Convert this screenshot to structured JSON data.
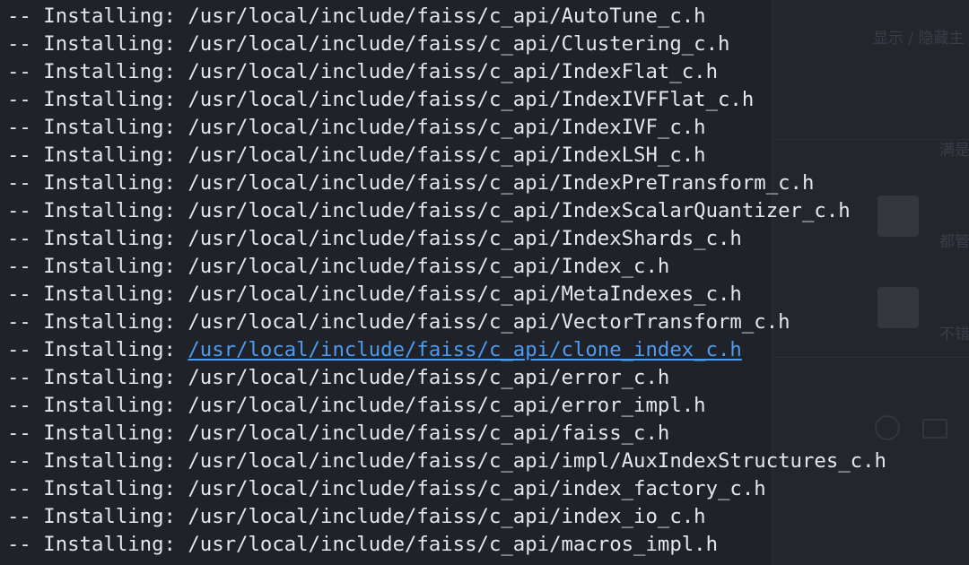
{
  "terminal": {
    "prefix": "-- Installing: ",
    "lines": [
      {
        "path": "/usr/local/include/faiss/c_api/AutoTune_c.h",
        "link": false
      },
      {
        "path": "/usr/local/include/faiss/c_api/Clustering_c.h",
        "link": false
      },
      {
        "path": "/usr/local/include/faiss/c_api/IndexFlat_c.h",
        "link": false
      },
      {
        "path": "/usr/local/include/faiss/c_api/IndexIVFFlat_c.h",
        "link": false
      },
      {
        "path": "/usr/local/include/faiss/c_api/IndexIVF_c.h",
        "link": false
      },
      {
        "path": "/usr/local/include/faiss/c_api/IndexLSH_c.h",
        "link": false
      },
      {
        "path": "/usr/local/include/faiss/c_api/IndexPreTransform_c.h",
        "link": false
      },
      {
        "path": "/usr/local/include/faiss/c_api/IndexScalarQuantizer_c.h",
        "link": false
      },
      {
        "path": "/usr/local/include/faiss/c_api/IndexShards_c.h",
        "link": false
      },
      {
        "path": "/usr/local/include/faiss/c_api/Index_c.h",
        "link": false
      },
      {
        "path": "/usr/local/include/faiss/c_api/MetaIndexes_c.h",
        "link": false
      },
      {
        "path": "/usr/local/include/faiss/c_api/VectorTransform_c.h",
        "link": false
      },
      {
        "path": "/usr/local/include/faiss/c_api/clone_index_c.h",
        "link": true
      },
      {
        "path": "/usr/local/include/faiss/c_api/error_c.h",
        "link": false
      },
      {
        "path": "/usr/local/include/faiss/c_api/error_impl.h",
        "link": false
      },
      {
        "path": "/usr/local/include/faiss/c_api/faiss_c.h",
        "link": false
      },
      {
        "path": "/usr/local/include/faiss/c_api/impl/AuxIndexStructures_c.h",
        "link": false
      },
      {
        "path": "/usr/local/include/faiss/c_api/index_factory_c.h",
        "link": false
      },
      {
        "path": "/usr/local/include/faiss/c_api/index_io_c.h",
        "link": false
      },
      {
        "path": "/usr/local/include/faiss/c_api/macros_impl.h",
        "link": false
      }
    ],
    "colors": {
      "background": "#1f2229",
      "text": "#e4e6ea",
      "link": "#4d9cf0"
    }
  },
  "background_app": {
    "header_text": "显示 / 隐藏主",
    "items": [
      "满是",
      "都管",
      "不错"
    ]
  }
}
